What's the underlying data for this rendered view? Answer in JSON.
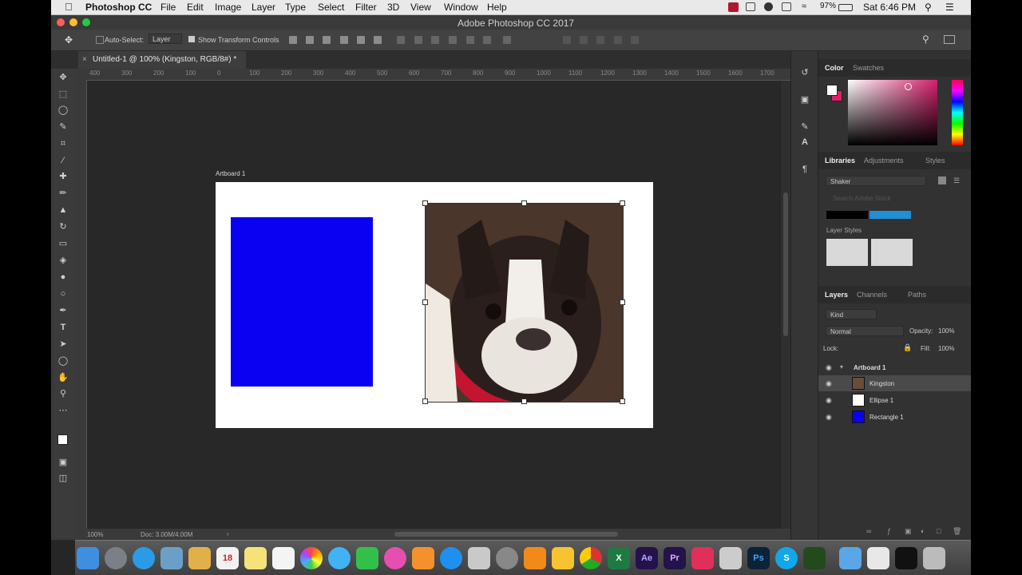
{
  "menu": {
    "app": "Photoshop CC",
    "items": [
      "File",
      "Edit",
      "Image",
      "Layer",
      "Type",
      "Select",
      "Filter",
      "3D",
      "View",
      "Window",
      "Help"
    ],
    "battery": "97%",
    "clock": "Sat 6:46 PM"
  },
  "window": {
    "title": "Adobe Photoshop CC 2017"
  },
  "options": {
    "auto_select": "Auto-Select:",
    "auto_select_value": "Layer",
    "show_transform": "Show Transform Controls"
  },
  "tab": {
    "label": "Untitled-1 @ 100% (Kingston, RGB/8#) *",
    "close": "×"
  },
  "ruler": {
    "h": [
      "400",
      "300",
      "200",
      "100",
      "0",
      "100",
      "200",
      "300",
      "400",
      "500",
      "600",
      "700",
      "800",
      "900",
      "1000",
      "1100",
      "1200",
      "1300",
      "1400",
      "1500",
      "1600",
      "1700"
    ]
  },
  "canvas": {
    "artboard_label": "Artboard 1"
  },
  "status": {
    "zoom": "100%",
    "doc": "Doc: 3.00M/4.00M",
    "arrow": "›"
  },
  "color_panel": {
    "tabs": [
      "Color",
      "Swatches"
    ],
    "fg": "#ffffff",
    "bg": "#e0206a"
  },
  "libraries_panel": {
    "tabs": [
      "Libraries",
      "Adjustments",
      "Styles"
    ],
    "library": "Shaker",
    "search_placeholder": "Search Adobe Stock",
    "section": "Layer Styles"
  },
  "layers_panel": {
    "tabs": [
      "Layers",
      "Channels",
      "Paths"
    ],
    "filter": "Kind",
    "blend": "Normal",
    "opacity_label": "Opacity:",
    "opacity": "100%",
    "lock_label": "Lock:",
    "fill_label": "Fill:",
    "fill": "100%",
    "group": "Artboard 1",
    "layers": [
      {
        "name": "Kingston"
      },
      {
        "name": "Ellipse 1"
      },
      {
        "name": "Rectangle 1"
      }
    ]
  },
  "colors": {
    "blue_rect": "#0a00f2",
    "accent": "#d4206a"
  },
  "dock": {
    "apps": [
      "Finder",
      "Launchpad",
      "Safari",
      "Preview",
      "Notes",
      "Calendar",
      "Stickies",
      "Reminders",
      "Photos",
      "Messages",
      "FaceTime",
      "iTunes",
      "iBooks",
      "App Store",
      "Preview",
      "System Preferences",
      "VLC",
      "Sketch",
      "Chrome",
      "Excel",
      "After Effects",
      "Premiere Pro",
      "Slack",
      "Tools",
      "Photoshop",
      "Skype",
      "Dreamweaver",
      "Folder",
      "Files",
      "Terminal",
      "Trash"
    ],
    "calendar_day": "18"
  }
}
